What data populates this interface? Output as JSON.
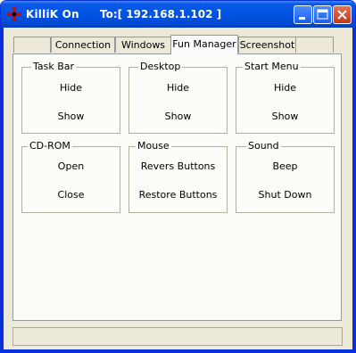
{
  "window": {
    "app_name": "KilliK On",
    "target": "To:[ 192.168.1.102 ]"
  },
  "titlebar_buttons": {
    "minimize_icon": "minimize-icon",
    "maximize_icon": "maximize-icon",
    "close_icon": "close-icon"
  },
  "tabs": [
    {
      "label": ""
    },
    {
      "label": "Connection"
    },
    {
      "label": "Windows"
    },
    {
      "label": "Fun Manager"
    },
    {
      "label": "Screenshot"
    },
    {
      "label": ""
    }
  ],
  "active_tab": "Fun Manager",
  "groups": [
    {
      "title": "Task Bar",
      "buttons": [
        "Hide",
        "Show"
      ]
    },
    {
      "title": "Desktop",
      "buttons": [
        "Hide",
        "Show"
      ]
    },
    {
      "title": "Start Menu",
      "buttons": [
        "Hide",
        "Show"
      ]
    },
    {
      "title": "CD-ROM",
      "buttons": [
        "Open",
        "Close"
      ]
    },
    {
      "title": "Mouse",
      "buttons": [
        "Revers Buttons",
        "Restore Buttons"
      ]
    },
    {
      "title": "Sound",
      "buttons": [
        "Beep",
        "Shut Down"
      ]
    }
  ],
  "colors": {
    "titlebar": "#0054e3",
    "window_bg": "#ece9d8",
    "panel_bg": "#fbfbf8"
  }
}
